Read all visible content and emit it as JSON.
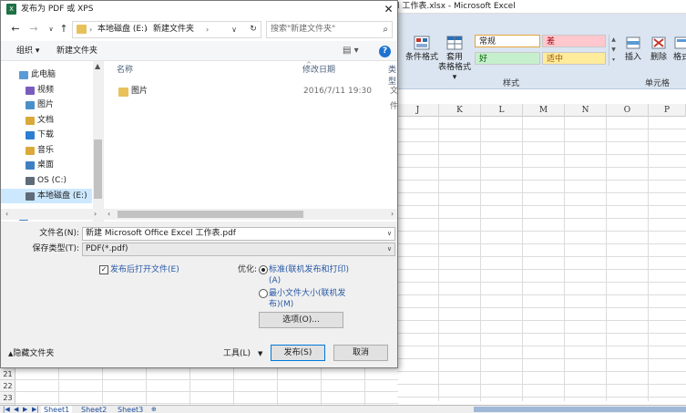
{
  "excel": {
    "title": "l 工作表.xlsx - Microsoft Excel",
    "ribbon": {
      "cond_format": "条件格式",
      "table_format_1": "套用",
      "table_format_2": "表格格式",
      "style_normal": "常规",
      "style_bad": "差",
      "style_good": "好",
      "style_neutral": "适中",
      "group_styles": "样式",
      "insert": "插入",
      "delete": "删除",
      "format": "格式",
      "group_cells": "单元格"
    },
    "columns": [
      "J",
      "K",
      "L",
      "M",
      "N",
      "O",
      "P"
    ],
    "rows": [
      "21",
      "22",
      "23"
    ],
    "sheets": [
      "Sheet1",
      "Sheet2",
      "Sheet3"
    ]
  },
  "dialog": {
    "title": "发布为 PDF 或 XPS",
    "address": [
      "本地磁盘 (E:)",
      "新建文件夹"
    ],
    "search_placeholder": "搜索\"新建文件夹\"",
    "toolbar": {
      "organize": "组织 ▾",
      "new_folder": "新建文件夹"
    },
    "nav_tree": [
      {
        "label": "此电脑",
        "color": "#5b9bd5"
      },
      {
        "label": "视频",
        "color": "#7a5cbf"
      },
      {
        "label": "图片",
        "color": "#4a90c8"
      },
      {
        "label": "文档",
        "color": "#d9a93a"
      },
      {
        "label": "下载",
        "color": "#2d7dd2"
      },
      {
        "label": "音乐",
        "color": "#d9a93a"
      },
      {
        "label": "桌面",
        "color": "#3e7fc1"
      },
      {
        "label": "OS (C:)",
        "color": "#5e6b78"
      },
      {
        "label": "本地磁盘 (E:)",
        "color": "#5e6b78"
      },
      {
        "label": "网络",
        "color": "#3e7fc1"
      }
    ],
    "columns": {
      "name": "名称",
      "modified": "修改日期",
      "type": "类型"
    },
    "files": [
      {
        "name": "图片",
        "modified": "2016/7/11 19:30",
        "type": "文件"
      }
    ],
    "filename_label": "文件名(N):",
    "filename_value": "新建 Microsoft Office Excel 工作表.pdf",
    "filetype_label": "保存类型(T):",
    "filetype_value": "PDF(*.pdf)",
    "open_after_publish": "发布后打开文件(E)",
    "optimize_label": "优化:",
    "opt_standard_1": "标准(联机发布和打印)",
    "opt_standard_2": "(A)",
    "opt_min_1": "最小文件大小(联机发",
    "opt_min_2": "布)(M)",
    "options_button": "选项(O)...",
    "hide_folders": "隐藏文件夹",
    "tools": "工具(L)",
    "publish": "发布(S)",
    "cancel": "取消"
  }
}
